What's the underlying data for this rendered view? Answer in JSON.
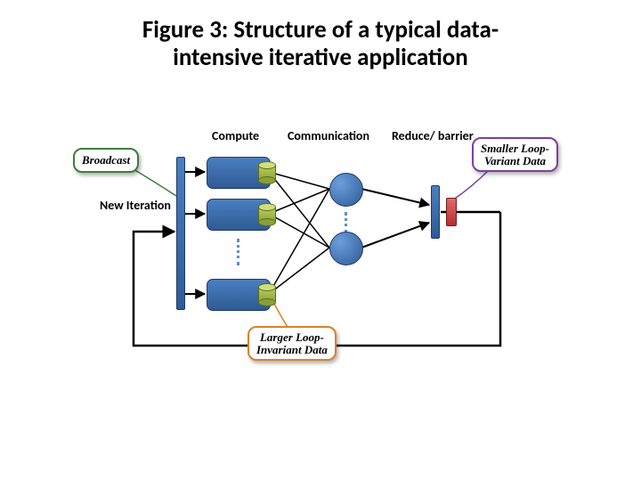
{
  "title_line1": "Figure 3: Structure of a typical data-",
  "title_line2": "intensive iterative application",
  "labels": {
    "compute": "Compute",
    "communication": "Communication",
    "reduce": "Reduce/ barrier",
    "new_iteration": "New Iteration"
  },
  "callouts": {
    "broadcast": "Broadcast",
    "smaller_l1": "Smaller Loop-",
    "smaller_l2": "Variant Data",
    "larger_l1": "Larger Loop-",
    "larger_l2": "Invariant Data"
  }
}
